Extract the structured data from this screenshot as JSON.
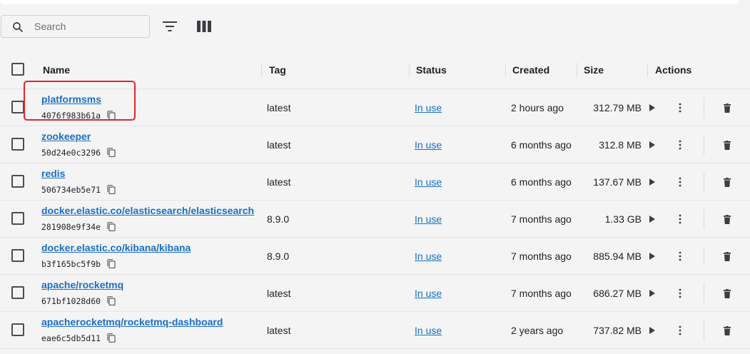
{
  "search": {
    "placeholder": "Search",
    "value": ""
  },
  "toolbar": {
    "filter_icon": "filter-icon",
    "columns_icon": "columns-icon"
  },
  "columns": {
    "name": "Name",
    "tag": "Tag",
    "status": "Status",
    "created": "Created",
    "size": "Size",
    "actions": "Actions"
  },
  "images": [
    {
      "name": "platformsms",
      "id": "4076f983b61a",
      "tag": "latest",
      "status": "In use",
      "created": "2 hours ago",
      "size": "312.79 MB"
    },
    {
      "name": "zookeeper",
      "id": "50d24e0c3296",
      "tag": "latest",
      "status": "In use",
      "created": "6 months ago",
      "size": "312.8 MB"
    },
    {
      "name": "redis",
      "id": "506734eb5e71",
      "tag": "latest",
      "status": "In use",
      "created": "6 months ago",
      "size": "137.67 MB"
    },
    {
      "name": "docker.elastic.co/elasticsearch/elasticsearch",
      "id": "281908e9f34e",
      "tag": "8.9.0",
      "status": "In use",
      "created": "7 months ago",
      "size": "1.33 GB"
    },
    {
      "name": "docker.elastic.co/kibana/kibana",
      "id": "b3f165bc5f9b",
      "tag": "8.9.0",
      "status": "In use",
      "created": "7 months ago",
      "size": "885.94 MB"
    },
    {
      "name": "apache/rocketmq",
      "id": "671bf1028d60",
      "tag": "latest",
      "status": "In use",
      "created": "7 months ago",
      "size": "686.27 MB"
    },
    {
      "name": "apacherocketmq/rocketmq-dashboard",
      "id": "eae6c5db5d11",
      "tag": "latest",
      "status": "In use",
      "created": "2 years ago",
      "size": "737.82 MB"
    }
  ],
  "colors": {
    "link": "#1a6fc4",
    "highlight_box": "#e5242b"
  }
}
